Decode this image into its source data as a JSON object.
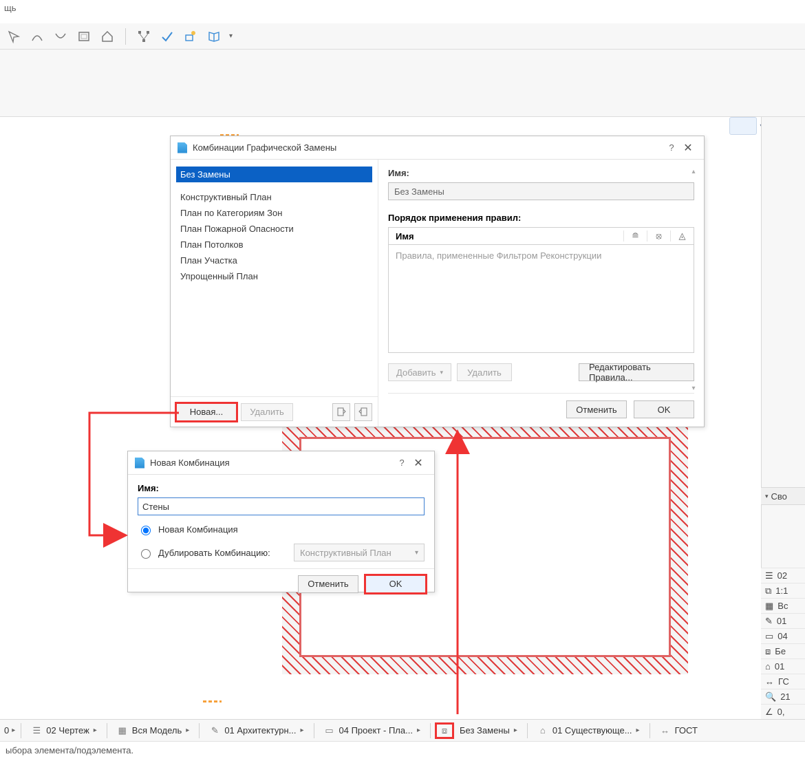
{
  "menubar": {
    "help": "щь"
  },
  "toolbar": {},
  "dialog1": {
    "title": "Комбинации Графической Замены",
    "help": "?",
    "close": "✕",
    "list": {
      "selected": "Без Замены",
      "items": [
        "Конструктивный План",
        "План по Категориям Зон",
        "План Пожарной Опасности",
        "План Потолков",
        "План Участка",
        "Упрощенный План"
      ]
    },
    "footer": {
      "new": "Новая...",
      "delete": "Удалить"
    },
    "right": {
      "name_label": "Имя:",
      "name_value": "Без Замены",
      "rules_label": "Порядок применения правил:",
      "rules_col_name": "Имя",
      "rules_placeholder": "Правила, примененные Фильтром Реконструкции",
      "add": "Добавить",
      "add_arrow": "▾",
      "remove": "Удалить",
      "edit_rules": "Редактировать Правила...",
      "cancel": "Отменить",
      "ok": "OK"
    }
  },
  "dialog2": {
    "title": "Новая Комбинация",
    "help": "?",
    "close": "✕",
    "name_label": "Имя:",
    "name_value": "Стены",
    "radio_new": "Новая Комбинация",
    "radio_dup": "Дублировать Комбинацию:",
    "dup_value": "Конструктивный План",
    "cancel": "Отменить",
    "ok": "OK"
  },
  "quickbar": {
    "num0": "0",
    "seg1": "02 Чертеж",
    "seg2": "Вся Модель",
    "seg3": "01 Архитектурн...",
    "seg4": "04 Проект - Пла...",
    "seg5": "Без Замены",
    "seg6": "01 Существующе...",
    "seg7": "ГОСТ"
  },
  "statusbar": {
    "text": "ыбора элемента/подэлемента."
  },
  "infolist": {
    "header": "Сво",
    "rows": [
      "02",
      "1:1",
      "Вс",
      "01",
      "04",
      "Бе",
      "01",
      "ГС",
      "21",
      "0,"
    ]
  }
}
